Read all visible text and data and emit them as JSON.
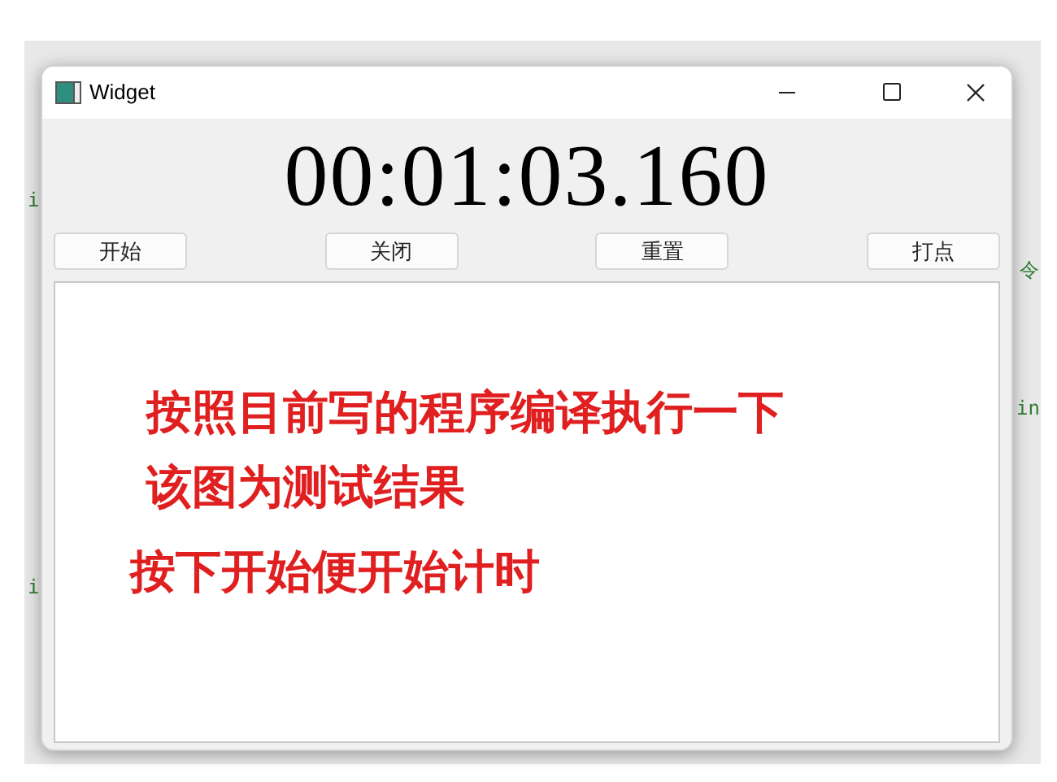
{
  "background_code_left": [
    "i",
    "i"
  ],
  "background_code_right": [
    "令",
    "in"
  ],
  "window": {
    "title": "Widget"
  },
  "timer": {
    "display": "00:01:03.160"
  },
  "buttons": [
    {
      "label": "开始"
    },
    {
      "label": "关闭"
    },
    {
      "label": "重置"
    },
    {
      "label": "打点"
    }
  ],
  "text_area": {
    "lines": [
      "按照目前写的程序编译执行一下",
      "该图为测试结果",
      "按下开始便开始计时"
    ]
  }
}
